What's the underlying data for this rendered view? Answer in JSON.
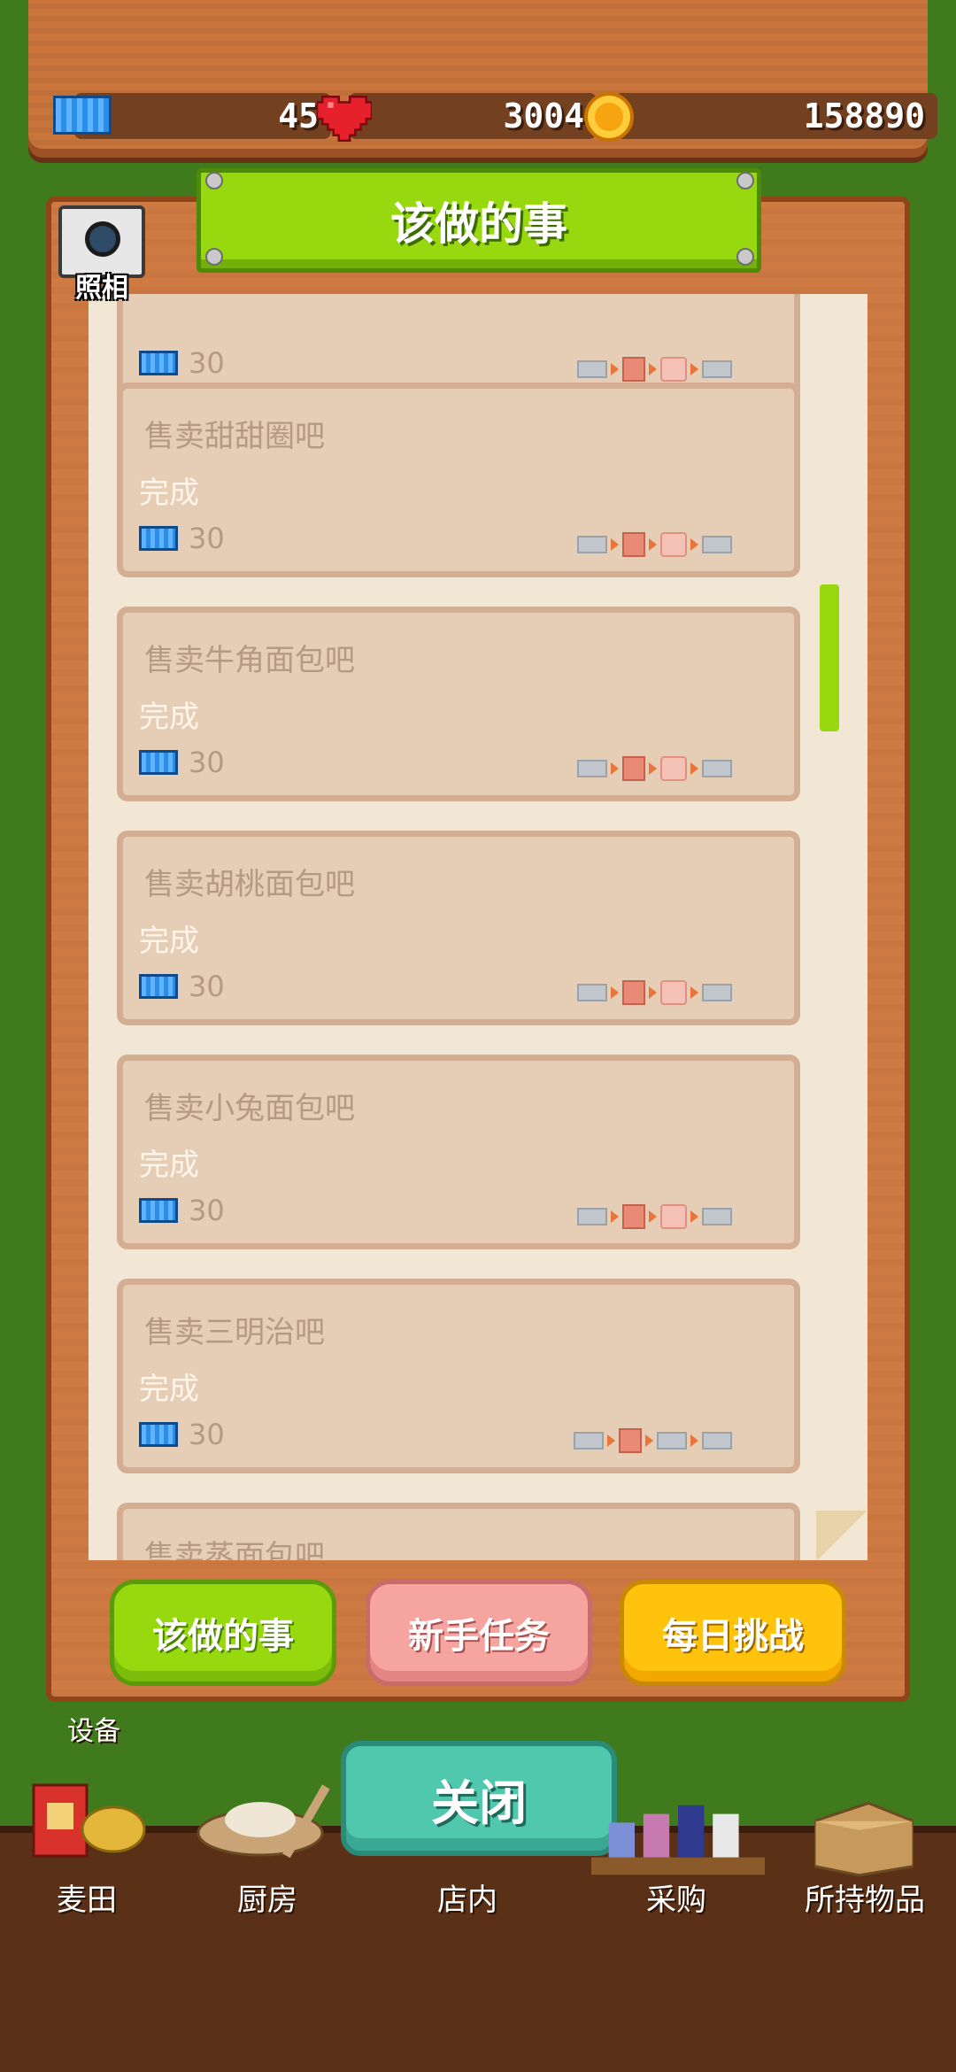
{
  "header": {
    "tickets": "45",
    "hearts": "3004",
    "coins": "158890"
  },
  "camera": {
    "label": "照相"
  },
  "panel": {
    "title": "该做的事"
  },
  "tasks": [
    {
      "title": "",
      "status": "",
      "reward": "30"
    },
    {
      "title": "售卖甜甜圈吧",
      "status": "完成",
      "reward": "30"
    },
    {
      "title": "售卖牛角面包吧",
      "status": "完成",
      "reward": "30"
    },
    {
      "title": "售卖胡桃面包吧",
      "status": "完成",
      "reward": "30"
    },
    {
      "title": "售卖小兔面包吧",
      "status": "完成",
      "reward": "30"
    },
    {
      "title": "售卖三明治吧",
      "status": "完成",
      "reward": "30"
    },
    {
      "title": "售卖蒸面包吧",
      "status": "",
      "reward": ""
    }
  ],
  "tabs": {
    "todo": "该做的事",
    "newbie": "新手任务",
    "daily": "每日挑战"
  },
  "close_button": "关闭",
  "equipment_label": "设备",
  "nav": {
    "wheat": "麦田",
    "kitchen": "厨房",
    "store": "店内",
    "purchase": "采购",
    "items": "所持物品"
  },
  "colors": {
    "accent_green": "#97d80f",
    "close_teal": "#4fc8ae",
    "newbie_pink": "#f5a4a0",
    "daily_yellow": "#ffc30d"
  }
}
